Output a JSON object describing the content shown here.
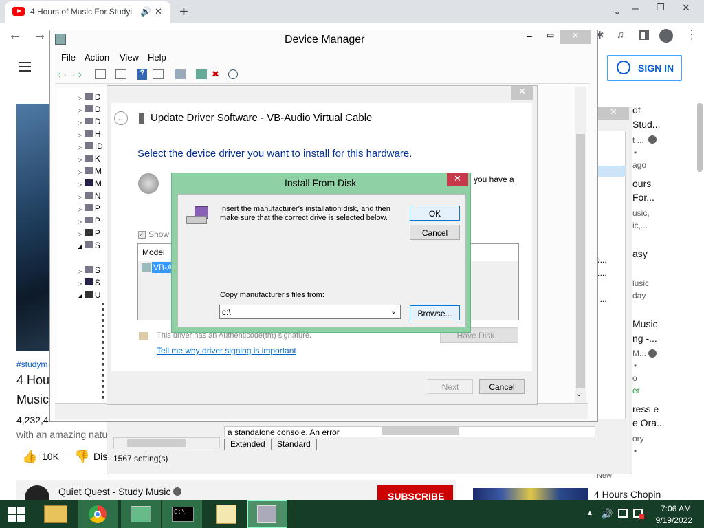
{
  "browser": {
    "tab_title": "4 Hours of Music For Studyi",
    "new_tab": "+",
    "window_controls": {
      "minimize": "–",
      "restore": "❐",
      "close": "✕"
    }
  },
  "youtube": {
    "sign_in": "SIGN IN",
    "hashtag": "#studym",
    "title_line1": "4 Hou",
    "title_line2": "Music",
    "views": "4,232,4",
    "desc": "with an amazing natu",
    "likes": "10K",
    "dislike": "Dis",
    "channel": "Quiet Quest - Study Music",
    "subscribe": "SUBSCRIBE",
    "bottom_rec_title": "4 Hours Chopin",
    "new_badge": "New",
    "right_fragments": [
      {
        "t": "of",
        "cls": "t"
      },
      {
        "t": "Stud...",
        "cls": "t"
      },
      {
        "t": "t ...",
        "cls": "s"
      },
      {
        "t": "•",
        "cls": "s"
      },
      {
        "t": "ago",
        "cls": "s"
      },
      {
        "t": "ours",
        "cls": "t"
      },
      {
        "t": "For...",
        "cls": "t"
      },
      {
        "t": "usic,",
        "cls": "s"
      },
      {
        "t": "ic,...",
        "cls": "s"
      },
      {
        "t": "asy",
        "cls": "t"
      },
      {
        "t": "lusic",
        "cls": "s"
      },
      {
        "t": "day",
        "cls": "s"
      },
      {
        "t": "Music",
        "cls": "t"
      },
      {
        "t": "ng -...",
        "cls": "t"
      },
      {
        "t": "M...",
        "cls": "s"
      },
      {
        "t": "•",
        "cls": "s"
      },
      {
        "t": "o",
        "cls": "s"
      },
      {
        "t": "er",
        "cls": "s"
      },
      {
        "t": "ress e",
        "cls": "t"
      },
      {
        "t": "e Ora...",
        "cls": "t"
      },
      {
        "t": "ory",
        "cls": "s"
      },
      {
        "t": "•",
        "cls": "s"
      }
    ],
    "mid_fragments": [
      "b...",
      "L...",
      "f ..."
    ]
  },
  "device_manager": {
    "title": "Device Manager",
    "menu": [
      "File",
      "Action",
      "View",
      "Help"
    ],
    "tree_letters": [
      "D",
      "D",
      "D",
      "H",
      "ID",
      "K",
      "M",
      "M",
      "N",
      "P",
      "P",
      "P",
      "S",
      "",
      "S",
      "S",
      "U"
    ],
    "console_text": "a standalone console. An error",
    "tabs": [
      "Extended",
      "Standard"
    ],
    "status": "1567 setting(s)"
  },
  "update_driver": {
    "title": "Update Driver Software - VB-Audio Virtual Cable",
    "heading": "Select the device driver you want to install for this hardware.",
    "you_have": "you have a",
    "show": "Show",
    "model_header": "Model",
    "model_item": "VB-A",
    "signature": "This driver has an Authenticode(tm) signature.",
    "link": "Tell me why driver signing is important",
    "have_disk": "Have Disk...",
    "next": "Next",
    "cancel": "Cancel"
  },
  "install_disk": {
    "title": "Install From Disk",
    "message": "Insert the manufacturer's installation disk, and then make sure that the correct drive is selected below.",
    "ok": "OK",
    "cancel": "Cancel",
    "copy_label": "Copy manufacturer's files from:",
    "path_value": "c:\\",
    "browse": "Browse..."
  },
  "taskbar": {
    "time": "7:06 AM",
    "date": "9/19/2022"
  },
  "colors": {
    "install_frame": "#8fd1a4",
    "taskbar": "#163d25",
    "link": "#0066cc",
    "heading": "#003399"
  }
}
